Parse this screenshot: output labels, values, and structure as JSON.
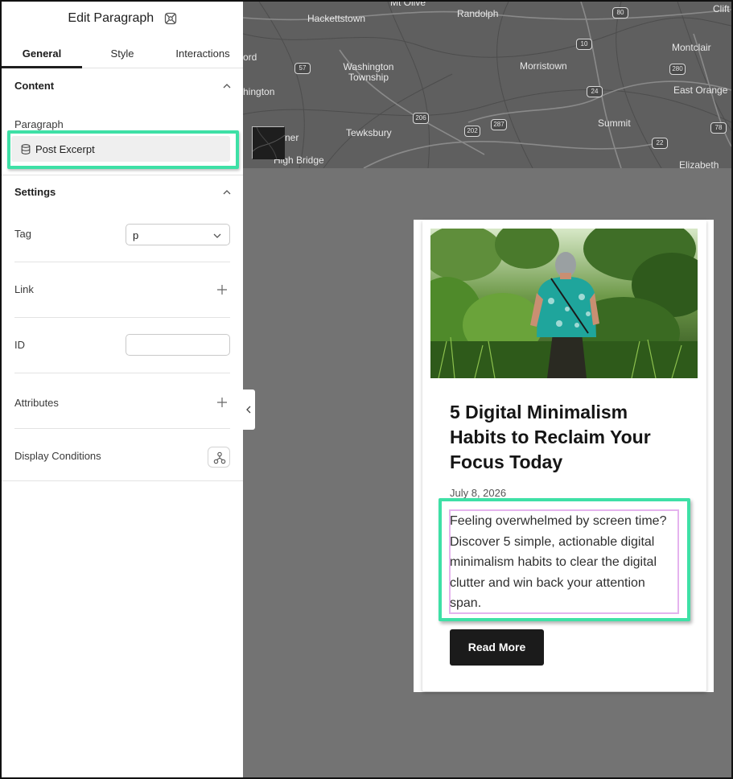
{
  "panel": {
    "title": "Edit Paragraph",
    "tabs": [
      "General",
      "Style",
      "Interactions"
    ],
    "content_section": {
      "heading": "Content",
      "paragraph_label": "Paragraph",
      "paragraph_value": "Post Excerpt"
    },
    "settings_section": {
      "heading": "Settings",
      "tag_label": "Tag",
      "tag_value": "p",
      "link_label": "Link",
      "id_label": "ID",
      "id_value": "",
      "attributes_label": "Attributes",
      "display_conditions_label": "Display Conditions"
    }
  },
  "map": {
    "places": [
      "Mt Olive",
      "Hackettstown",
      "Randolph",
      "Clift",
      "Montclair",
      "Washington Township",
      "Morristown",
      "East Orange",
      "ord",
      "hington",
      "Tewksbury",
      "Summit",
      "ner",
      "High Bridge",
      "Elizabeth"
    ],
    "routes": [
      "57",
      "80",
      "10",
      "280",
      "24",
      "206",
      "202",
      "287",
      "22",
      "78"
    ]
  },
  "card": {
    "title": "5 Digital Minimalism Habits to Reclaim Your Focus Today",
    "date": "July 8, 2026",
    "excerpt": "Feeling overwhelmed by screen time? Discover 5 simple, actionable digital minimalism habits to clear the digital clutter and win back your attention span.",
    "button": "Read More"
  },
  "colors": {
    "highlight": "#3ee0a6",
    "selection_outline": "#e5b3ee",
    "canvas_bg": "#737373",
    "button_bg": "#1b1b1b"
  },
  "icons": [
    "element-icon",
    "chevron-up-icon",
    "database-icon",
    "chevron-down-icon",
    "plus-icon",
    "conditions-icon",
    "chevron-left-icon"
  ]
}
